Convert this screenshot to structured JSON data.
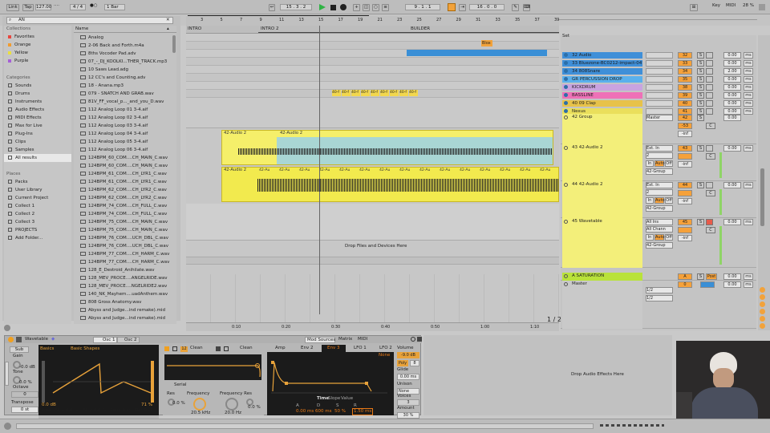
{
  "transport": {
    "link": "Link",
    "tap": "Tap",
    "tempo": "127.00",
    "dot_sep": "····",
    "sig": "4 / 4",
    "metro": "●○",
    "quant": "1 Bar",
    "pos": "15 .  3 .  2",
    "loop_start": "9 .  1 .  1",
    "loop_len": "16 .  0 .  0",
    "key": "Key",
    "midi": "MIDI",
    "cpu": "28 %"
  },
  "browser": {
    "search": "AN",
    "collections_title": "Collections",
    "collections": [
      {
        "label": "Favorites",
        "color": "#e8463e"
      },
      {
        "label": "Orange",
        "color": "#f19b2e"
      },
      {
        "label": "Yellow",
        "color": "#eadf3f"
      },
      {
        "label": "Purple",
        "color": "#a65fd6"
      }
    ],
    "categories_title": "Categories",
    "categories": [
      "Sounds",
      "Drums",
      "Instruments",
      "Audio Effects",
      "MIDI Effects",
      "Max for Live",
      "Plug-Ins",
      "Clips",
      "Samples",
      "All results"
    ],
    "places_title": "Places",
    "places": [
      "Packs",
      "User Library",
      "Current Project",
      "Collect 1",
      "Collect 2",
      "Collect 3",
      "PROJECTS",
      "Add Folder..."
    ],
    "name_header": "Name",
    "files": [
      "Analog",
      "2-06 Back and Forth.m4a",
      "8ths Vocoder Pad.adv",
      "07_-_DJ_KOOLKI...THER_TRACK.mp3",
      "10 Saws Lead.adg",
      "12 CC's and Counting.adv",
      "18 - Anana.mp3",
      "079 - SNATCH AND GRAB.wav",
      "81V_FF_vocal_p..._and_you_D.wav",
      "112 Analog Loop 01 3-4.aif",
      "112 Analog Loop 02 3-4.aif",
      "112 Analog Loop 03 3-4.aif",
      "112 Analog Loop 04 3-4.aif",
      "112 Analog Loop 05 3-4.aif",
      "112 Analog Loop 06 3-4.aif",
      "124BPM_60_COM....CH_MAIN_C.wav",
      "124BPM_60_COM....CH_MAIN_C.wav",
      "124BPM_61_COM....CH_LYR1_C.wav",
      "124BPM_61_COM....CH_LYR1_C.wav",
      "124BPM_62_COM....CH_LYR2_C.wav",
      "124BPM_62_COM....CH_LYR2_C.wav",
      "124BPM_74_COM....CH_FULL_C.wav",
      "124BPM_74_COM....CH_FULL_C.wav",
      "124BPM_75_COM....CH_MAIN_C.wav",
      "124BPM_75_COM....CH_MAIN_C.wav",
      "124BPM_76_COM....UCH_DBL_C.wav",
      "124BPM_76_COM....UCH_DBL_C.wav",
      "124BPM_77_COM....CH_HARM_C.wav",
      "124BPM_77_COM....CH_HARM_C.wav",
      "128_E_Destroid_Anihilate.wav",
      "128_MEV_PROCE....ANGELRIDE.wav",
      "128_MEV_PROCE....NGELRIDE2.wav",
      "140_NK_Mayhem....uadAnthem.wav",
      "808 Gross Anatomy.wav",
      "Abyss and Judge...ind remake).mid",
      "Abyss and Judge...ind remake).mid"
    ]
  },
  "arrangement": {
    "ruler": [
      "3",
      "5",
      "7",
      "9",
      "11",
      "13",
      "15",
      "17",
      "19",
      "21",
      "23",
      "25",
      "27",
      "29",
      "31",
      "33",
      "35",
      "37",
      "39"
    ],
    "locators": [
      "INTRO",
      "INTRO 2",
      "BUILDER"
    ],
    "blox_clip": "Blox",
    "small_clips": "40-f",
    "audio_clip": "42-Audio 2",
    "audio_clip_short": "42-Au",
    "drop_hint": "Drop Files and Devices Here",
    "page": "1 / 2",
    "time_ruler": [
      "0:10",
      "0:20",
      "0:30",
      "0:40",
      "0:50",
      "1:00",
      "1:10"
    ]
  },
  "mixer": {
    "set_label": "Set",
    "tracks": [
      {
        "name": "32 Audio",
        "color": "#3f8fd8",
        "num": "32",
        "vol": "0.00"
      },
      {
        "name": "33 Bluezone-BC0212-impact-047",
        "color": "#3f8fd8",
        "num": "33",
        "vol": "0.00"
      },
      {
        "name": "34 808Snare",
        "color": "#3f8fd8",
        "num": "34",
        "vol": "2.00"
      },
      {
        "name": "GR PERCUSSION DROP",
        "color": "#5ab0ec",
        "num": "35",
        "vol": "0.00"
      },
      {
        "name": "KICKDRUM",
        "color": "#c9a3e0",
        "num": "38",
        "vol": "0.00"
      },
      {
        "name": "BASSLINE",
        "color": "#ee71b7",
        "num": "39",
        "vol": "0.00"
      },
      {
        "name": "40 09 Clap",
        "color": "#e7c24a",
        "num": "40",
        "vol": "0.00"
      },
      {
        "name": "Nexus",
        "color": "#eadf5c",
        "num": "41",
        "vol": "0.00"
      }
    ],
    "group": {
      "name": "42 Group",
      "num": "42",
      "vol": "0.00",
      "master": "Master",
      "send": "-53",
      "inf": "-inf"
    },
    "audio43": {
      "name": "43 42-Audio 2",
      "num": "43",
      "vol": "0.00",
      "input": "Ext. In",
      "chan": "2",
      "group": "42-Group",
      "in": "In",
      "auto": "Auto",
      "off": "Off",
      "inf": "-inf"
    },
    "audio44": {
      "name": "44 42-Audio 2",
      "num": "44",
      "vol": "0.00",
      "input": "Ext. In",
      "chan": "2",
      "group": "42-Group",
      "in": "In",
      "auto": "Auto",
      "off": "Off",
      "inf": "-inf"
    },
    "wavetable": {
      "name": "45 Wavetable",
      "num": "45",
      "vol": "0.00",
      "input": "All Ins",
      "chan": "All Chann",
      "group": "42-Group",
      "in": "In",
      "auto": "Auto",
      "off": "Off",
      "inf": "-inf"
    },
    "saturation": {
      "name": "A SATURATION",
      "letter": "A",
      "post": "Post",
      "vol": "0.00"
    },
    "master": {
      "name": "Master",
      "vol": "0.00",
      "cue": "1/2",
      "out": "1/2",
      "val": "0"
    },
    "s": "S",
    "c": "C",
    "ms": "ms"
  },
  "device": {
    "title": "Wavetable",
    "osc1": "Osc 1",
    "osc2": "Osc 2",
    "sub": "Sub",
    "gain": "Gain",
    "gain_val": "-0.0 dB",
    "tone": "Tone",
    "tone_val": "0.0 %",
    "octave": "Octave",
    "octave_val": "0",
    "transpose": "Transpose",
    "transpose_val": "0 st",
    "basics": "Basics",
    "shapes": "Basic Shapes",
    "osc_gain": "0.0 dB",
    "osc_pct": "71 %",
    "none": "None",
    "fx1": "FX 1 0.0 %",
    "fx2": "FX 2 0.0 %",
    "semi": "Semi 0 st",
    "det": "Det 0 ct",
    "filter_type": "Clean",
    "filter_num": "12",
    "serial": "Serial",
    "res": "Res",
    "res_val": "0.0 %",
    "freq": "Frequency",
    "freq_val": "20.5 kHz",
    "freq_res": "Frequency Res",
    "freq2_val": "20.0 Hz",
    "res2_val": "0.0 %",
    "mod_sources": "Mod Sources",
    "matrix": "Matrix",
    "midi": "MIDI",
    "amp": "Amp",
    "env2": "Env 2",
    "env3": "Env 3",
    "lfo1": "LFO 1",
    "lfo2": "LFO 2",
    "time": "Time",
    "slope": "Slope",
    "value": "Value",
    "a": "A",
    "d": "D",
    "s": "S",
    "r": "R",
    "a_val": "0.00 ms",
    "d_val": "600 ms",
    "s_val": "50 %",
    "r_val": "1.50 ms",
    "volume": "Volume",
    "volume_val": "-9.0 dB",
    "poly": "Poly",
    "poly_val": "8",
    "glide": "Glide",
    "glide_val": "0.00 ms",
    "unison": "Unison",
    "unison_val": "None",
    "voices": "Voices",
    "voices_val": "3",
    "amount": "Amount",
    "amount_val": "30 %",
    "drop_effects": "Drop Audio Effects Here"
  }
}
